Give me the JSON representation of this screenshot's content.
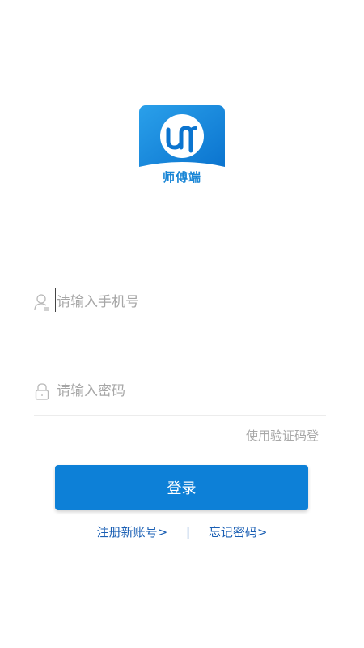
{
  "app": {
    "logo_name": "师傅端",
    "logo_icon": "um-logo-icon",
    "brand_color": "#0d80d7"
  },
  "phone": {
    "placeholder": "请输入手机号",
    "value": "",
    "icon": "user-icon"
  },
  "password": {
    "placeholder": "请输入密码",
    "value": "",
    "icon": "lock-icon"
  },
  "switch_login": "使用验证码登",
  "login_button": "登录",
  "links": {
    "register": "注册新账号>",
    "divider": "|",
    "forgot": "忘记密码>"
  },
  "colors": {
    "primary": "#0d80d7",
    "link": "#1a5fb4",
    "placeholder": "#a6a6a6"
  }
}
